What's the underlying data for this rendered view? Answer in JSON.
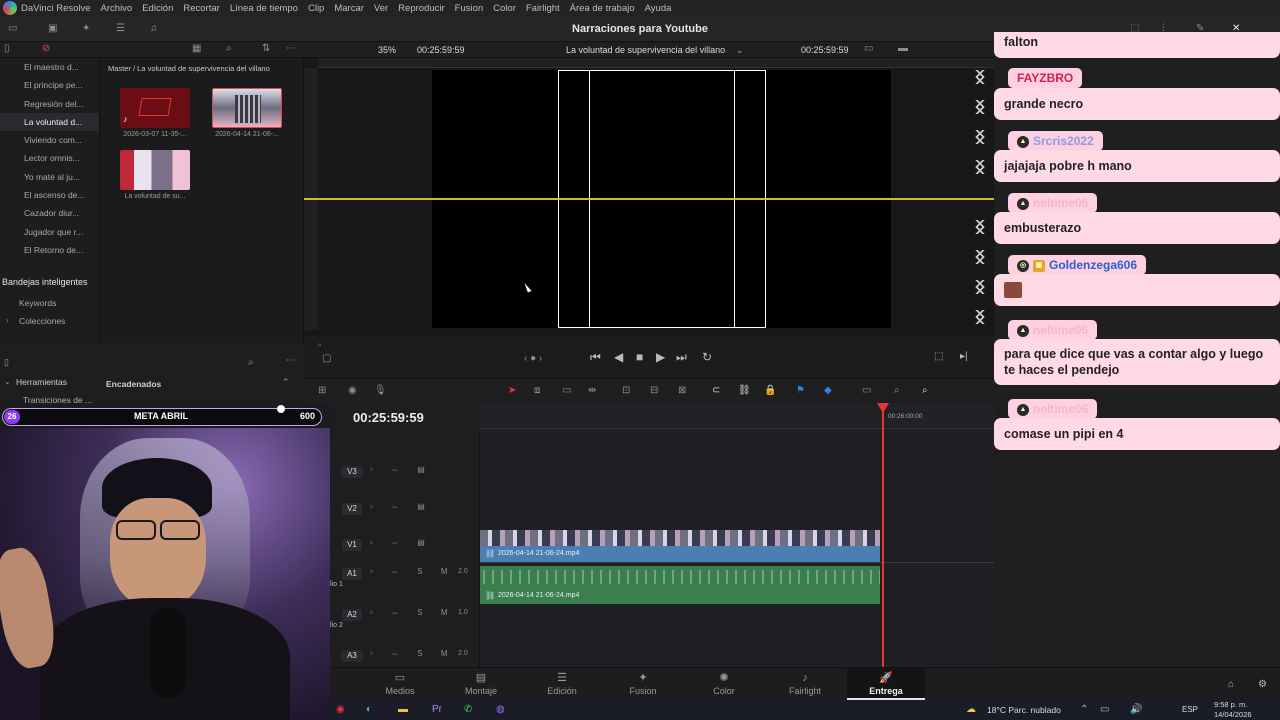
{
  "menubar": {
    "items": [
      "DaVinci Resolve",
      "Archivo",
      "Edición",
      "Recortar",
      "Línea de tiempo",
      "Clip",
      "Marcar",
      "Ver",
      "Reproducir",
      "Fusion",
      "Color",
      "Fairlight",
      "Área de trabajo",
      "Ayuda"
    ]
  },
  "project": {
    "title": "Narraciones para Youtube"
  },
  "viewer_bar": {
    "zoom": "35%",
    "timecode_left": "00:25:59:59",
    "timeline_name": "La voluntad de supervivencia del villano",
    "timecode_right": "00:25:59:59"
  },
  "bins": {
    "items": [
      "El maestro d...",
      "El principe pe...",
      "Regresión del...",
      "La voluntad d...",
      "Viviendo com...",
      "Lector omnis...",
      "Yo maté al ju...",
      "El ascenso de...",
      "Cazador diur...",
      "Jugador que r...",
      "El Retorno de..."
    ],
    "active_index": 3
  },
  "smart_bins": {
    "title": "Bandejas inteligentes",
    "items": [
      "Keywords",
      "Colecciones"
    ]
  },
  "media_pool": {
    "path": "Master / La voluntad de supervivencia del villano",
    "clips": [
      {
        "label": "2026-03-07 11-35-..."
      },
      {
        "label": "2026-04-14 21-06-..."
      },
      {
        "label": "La voluntad de su..."
      }
    ]
  },
  "lower_left": {
    "tools": "Herramientas",
    "transitions": "Transiciones de ...",
    "encadenados": "Encadenados"
  },
  "meta": {
    "badge": "26",
    "label": "META ABRIL",
    "goal": "600"
  },
  "timeline": {
    "timecode": "00:25:59:59",
    "ruler_mark": "00:26:00:00",
    "tracks": [
      {
        "name": "V3",
        "val": ""
      },
      {
        "name": "V2",
        "val": ""
      },
      {
        "name": "V1",
        "val": ""
      },
      {
        "name": "A1",
        "val": "2.0",
        "sub": "lio 1"
      },
      {
        "name": "A2",
        "val": "1.0",
        "sub": "lio 2"
      },
      {
        "name": "A3",
        "val": "2.0"
      }
    ],
    "video_clip": "2026-04-14 21-06-24.mp4",
    "audio_clip": "2026-04-14 21-06-24.mp4"
  },
  "pages": [
    {
      "label": "Medios",
      "icon": "media-icon"
    },
    {
      "label": "Montaje",
      "icon": "cut-icon"
    },
    {
      "label": "Edición",
      "icon": "edit-icon"
    },
    {
      "label": "Fusion",
      "icon": "fusion-icon"
    },
    {
      "label": "Color",
      "icon": "color-icon"
    },
    {
      "label": "Fairlight",
      "icon": "fairlight-icon"
    },
    {
      "label": "Entrega",
      "icon": "deliver-icon"
    }
  ],
  "active_page": "Entrega",
  "taskbar": {
    "weather": "18°C  Parc. nublado",
    "lang": "ESP",
    "time": "9:58 p. m.",
    "date": "14/04/2026"
  },
  "chat": [
    {
      "user": "",
      "text": "falton",
      "user_color": "#d1204e"
    },
    {
      "user": "FAYZBRO",
      "text": "grande necro",
      "user_color": "#d1204e"
    },
    {
      "user": "Srcris2022",
      "text": "jajajaja pobre h mano",
      "user_color": "#8a9ce6"
    },
    {
      "user": "neltime06",
      "text": "embusterazo",
      "user_color": "#f2b8c6"
    },
    {
      "user": "Goldenzega606",
      "text": "",
      "user_color": "#2b5fd8"
    },
    {
      "user": "neltime06",
      "text": "para que dice que vas a contar algo y luego te haces el pendejo",
      "user_color": "#f2b8c6"
    },
    {
      "user": "neltime06",
      "text": "comase un pipi en 4",
      "user_color": "#f2b8c6"
    }
  ],
  "colors": {
    "accent_playhead": "#e33",
    "video_clip": "#4a7fb2",
    "audio_clip": "#3c7f4f",
    "chat_bubble": "#ffd9e4"
  }
}
